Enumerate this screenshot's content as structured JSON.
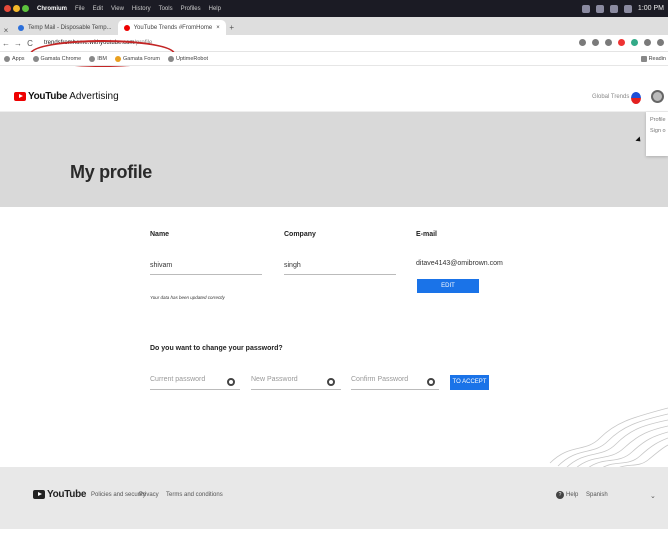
{
  "menubar": {
    "app": "Chromium",
    "items": [
      "File",
      "Edit",
      "View",
      "History",
      "Tools",
      "Profiles",
      "Help"
    ],
    "time": "1:00 PM"
  },
  "tabs": [
    {
      "label": "Temp Mail - Disposable Temp..."
    },
    {
      "label": "YouTube Trends #FromHome"
    }
  ],
  "address": {
    "domain": "trendsfromhome.withyoutube.com",
    "path": "/profile"
  },
  "bookmarks": [
    "Apps",
    "Gamata Chrome",
    "IBM",
    "Gamata Forum",
    "UptimeRobot"
  ],
  "bookmarks_right": "Readin",
  "header": {
    "brand_word": "YouTube",
    "brand_suffix": "Advertising",
    "global_trends": "Global Trends"
  },
  "dropdown": {
    "profile": "Profile",
    "sign_out": "Sign o"
  },
  "hero": {
    "title": "My profile"
  },
  "form": {
    "name_label": "Name",
    "company_label": "Company",
    "email_label": "E-mail",
    "name_value": "shivam",
    "company_value": "singh",
    "email_value": "ditave4143@omibrown.com",
    "edit_label": "EDIT",
    "saved_note": "Your data has been updated correctly",
    "password_question": "Do you want to change your password?",
    "current_pw_placeholder": "Current password",
    "new_pw_placeholder": "New Password",
    "confirm_pw_placeholder": "Confirm Password",
    "accept_label": "TO ACCEPT"
  },
  "footer": {
    "brand_word": "YouTube",
    "links": [
      "Policies and security",
      "Privacy",
      "Terms and conditions"
    ],
    "help": "Help",
    "language": "Spanish"
  },
  "colors": {
    "accent": "#1a73e8",
    "brand": "#e00000",
    "annotation": "#c32525"
  }
}
